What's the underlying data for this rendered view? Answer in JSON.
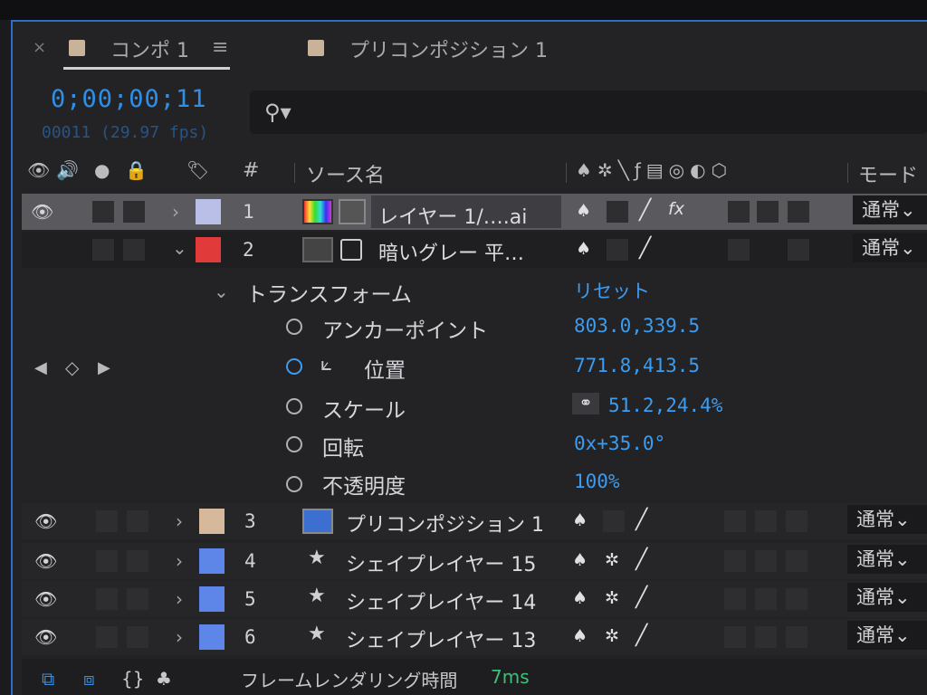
{
  "tabs": [
    {
      "label": "コンポ 1",
      "swatch": "#c9b29a",
      "close": "×",
      "active": true
    },
    {
      "label": "プリコンポジション 1",
      "swatch": "#c9b29a",
      "active": false
    }
  ],
  "timecode": {
    "value": "0;00;00;11",
    "frames": "00011 (29.97 fps)"
  },
  "search": {
    "icon": "search-icon",
    "placeholder": ""
  },
  "columns": {
    "hash": "#",
    "source_name": "ソース名",
    "mode": "モード"
  },
  "layers": [
    {
      "num": "1",
      "name": "レイヤー 1/….ai",
      "color": "#b9bfe6",
      "expanded": false,
      "selected": true,
      "mode": "通常"
    },
    {
      "num": "2",
      "name": "暗いグレー 平…",
      "color": "#e03a3a",
      "expanded": true,
      "selected": false,
      "mode": "通常"
    },
    {
      "num": "3",
      "name": "プリコンポジション 1",
      "color": "#d6b89a",
      "expanded": false,
      "selected": false,
      "mode": "通常"
    },
    {
      "num": "4",
      "name": "シェイプレイヤー 15",
      "color": "#5d86e8",
      "expanded": false,
      "selected": false,
      "mode": "通常"
    },
    {
      "num": "5",
      "name": "シェイプレイヤー 14",
      "color": "#5d86e8",
      "expanded": false,
      "selected": false,
      "mode": "通常"
    },
    {
      "num": "6",
      "name": "シェイプレイヤー 13",
      "color": "#5d86e8",
      "expanded": false,
      "selected": false,
      "mode": "通常"
    }
  ],
  "transform": {
    "label": "トランスフォーム",
    "reset": "リセット",
    "properties": [
      {
        "name": "アンカーポイント",
        "value": "803.0,339.5"
      },
      {
        "name": "位置",
        "value": "771.8,413.5",
        "keyframed": true
      },
      {
        "name": "スケール",
        "value": "51.2,24.4%"
      },
      {
        "name": "回転",
        "value": "0x+35.0°"
      },
      {
        "name": "不透明度",
        "value": "100%"
      }
    ]
  },
  "footer": {
    "label": "フレームレンダリング時間",
    "value": "7ms"
  }
}
